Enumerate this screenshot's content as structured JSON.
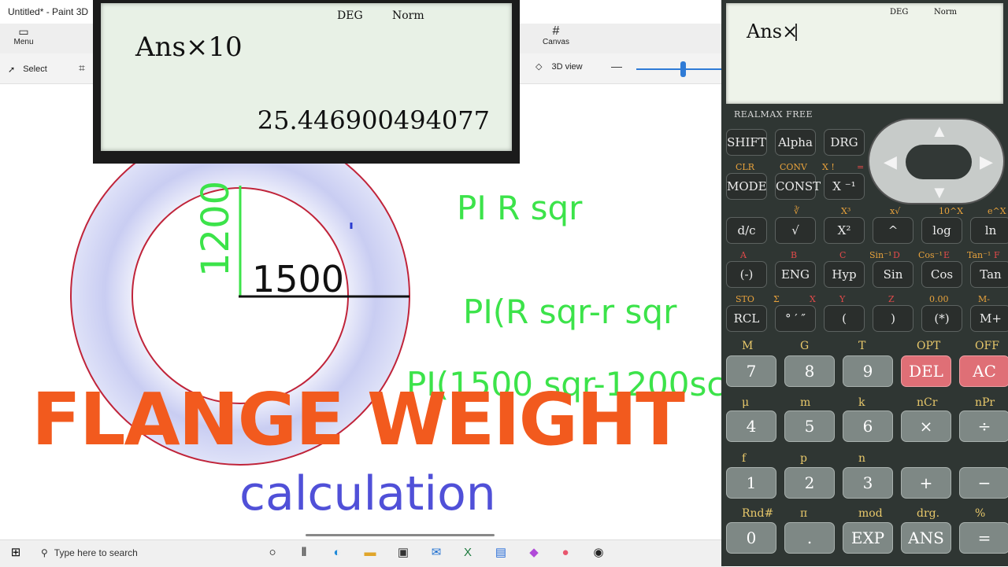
{
  "paint3d": {
    "title": "Untitled* - Paint 3D",
    "menu_label": "Menu",
    "canvas_label": "Canvas",
    "select_label": "Select",
    "view3d_label": "3D view"
  },
  "display_overlay": {
    "mode": "DEG",
    "format": "Norm",
    "expression": "Ans×10",
    "result": "25.446900494077"
  },
  "drawing": {
    "vertical_dim": "1200",
    "horizontal_dim": "1500",
    "formula1": "PI R sqr",
    "formula2": "PI(R sqr-r sqr",
    "formula3": "PI(1500 sqr-1200sc",
    "title": "FLANGE WEIGHT",
    "subtitle": "calculation",
    "colors": {
      "outer_circle": "#c0243a",
      "inner_circle": "#c0243a",
      "title": "#f25a1e",
      "subtitle": "#5050d8",
      "formula": "#3ce34a"
    }
  },
  "taskbar": {
    "search_placeholder": "Type here to search",
    "icons": [
      "windows-start-icon",
      "search-icon",
      "task-view-icon",
      "timeline-icon",
      "edge-icon",
      "file-explorer-icon",
      "store-icon",
      "mail-icon",
      "excel-icon",
      "photos-icon",
      "paint3d-icon",
      "paint-icon",
      "obs-icon"
    ]
  },
  "calculator": {
    "brand": "REALMAX FREE",
    "lcd": {
      "mode": "DEG",
      "format": "Norm",
      "expression": "Ans×"
    },
    "row1": [
      "SHIFT",
      "Alpha",
      "DRG"
    ],
    "row2_labels": [
      "CLR",
      "CONV",
      "X !",
      "="
    ],
    "row2": [
      "MODE",
      "CONST",
      "X ⁻¹"
    ],
    "row3_labels": [
      "∛",
      "X³",
      "x√",
      "10^X",
      "e^X"
    ],
    "row3": [
      "d/c",
      "√",
      "X²",
      "^",
      "log",
      "ln"
    ],
    "row4_labels": [
      "A",
      "B",
      "C",
      "Sin⁻¹",
      "D",
      "Cos⁻¹",
      "E",
      "Tan⁻¹",
      "F"
    ],
    "row4": [
      "(-)",
      "ENG",
      "Hyp",
      "Sin",
      "Cos",
      "Tan"
    ],
    "row5_labels": [
      "STO",
      "Σ",
      "X",
      "Y",
      "Z",
      "0.00",
      "M-"
    ],
    "row5": [
      "RCL",
      "° ′ ″",
      "(",
      ")",
      "(*)",
      "M+"
    ],
    "row6_labels": [
      "M",
      "G",
      "T",
      "OPT",
      "OFF"
    ],
    "row6": [
      "7",
      "8",
      "9",
      "DEL",
      "AC"
    ],
    "row7_labels": [
      "μ",
      "m",
      "k",
      "nCr",
      "nPr"
    ],
    "row7": [
      "4",
      "5",
      "6",
      "×",
      "÷"
    ],
    "row8_labels": [
      "f",
      "p",
      "n"
    ],
    "row8": [
      "1",
      "2",
      "3",
      "+",
      "−"
    ],
    "row9_labels": [
      "Rnd#",
      "π",
      "mod",
      "drg.",
      "%"
    ],
    "row9": [
      "0",
      ".",
      "EXP",
      "ANS",
      "="
    ]
  }
}
